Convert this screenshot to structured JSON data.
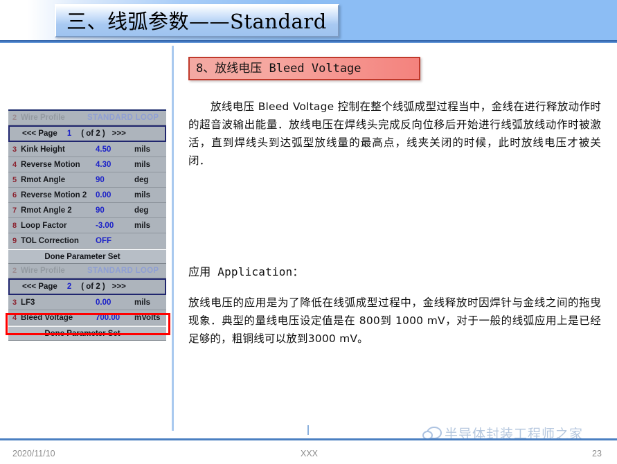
{
  "slide": {
    "title": "三、线弧参数——Standard"
  },
  "machine_panel": {
    "page1": {
      "profile": {
        "index": "2",
        "name": "Wire Profile",
        "value": "STANDARD LOOP"
      },
      "pager": {
        "prev": "<<< Page",
        "page": "1",
        "of": "( of 2 )",
        "next": ">>>"
      },
      "rows": [
        {
          "index": "3",
          "name": "Kink Height",
          "value": "4.50",
          "unit": "mils"
        },
        {
          "index": "4",
          "name": "Reverse Motion",
          "value": "4.30",
          "unit": "mils"
        },
        {
          "index": "5",
          "name": "Rmot Angle",
          "value": "90",
          "unit": "deg"
        },
        {
          "index": "6",
          "name": "Reverse Motion 2",
          "value": "0.00",
          "unit": "mils"
        },
        {
          "index": "7",
          "name": "Rmot Angle 2",
          "value": "90",
          "unit": "deg"
        },
        {
          "index": "8",
          "name": "Loop Factor",
          "value": "-3.00",
          "unit": "mils"
        },
        {
          "index": "9",
          "name": "TOL Correction",
          "value": "OFF",
          "unit": ""
        }
      ],
      "done": "Done Parameter Set"
    },
    "page2": {
      "profile": {
        "index": "2",
        "name": "Wire Profile",
        "value": "STANDARD LOOP"
      },
      "pager": {
        "prev": "<<< Page",
        "page": "2",
        "of": "( of 2 )",
        "next": ">>>"
      },
      "rows": [
        {
          "index": "3",
          "name": "LF3",
          "value": "0.00",
          "unit": "mils"
        },
        {
          "index": "4",
          "name": "Bleed Voltage",
          "value": "700.00",
          "unit": "mVolts"
        }
      ],
      "done": "Done Parameter Set"
    },
    "highlight_color": "#ff0000"
  },
  "content": {
    "heading": "8、放线电压 Bleed Voltage",
    "paragraph": "放线电压 Bleed Voltage 控制在整个线弧成型过程当中，金线在进行释放动作时的超音波输出能量．放线电压在焊线头完成反向位移后开始进行线弧放线动作时被激活，直到焊线头到达弧型放线量的最高点，线夹关闭的时候，此时放线电压才被关闭．",
    "application_label": "应用 Application：",
    "application_paragraph": "放线电压的应用是为了降低在线弧成型过程中，金线释放时因焊针与金线之间的拖曳现象．典型的量线电压设定值是在 800到 1000 mV，对于一般的线弧应用上是已经足够的，粗铜线可以放到3000 mV。"
  },
  "footer": {
    "date": "2020/11/10",
    "center": "XXX",
    "page_number": "23"
  },
  "watermark": {
    "text": "半导体封装工程师之家"
  }
}
